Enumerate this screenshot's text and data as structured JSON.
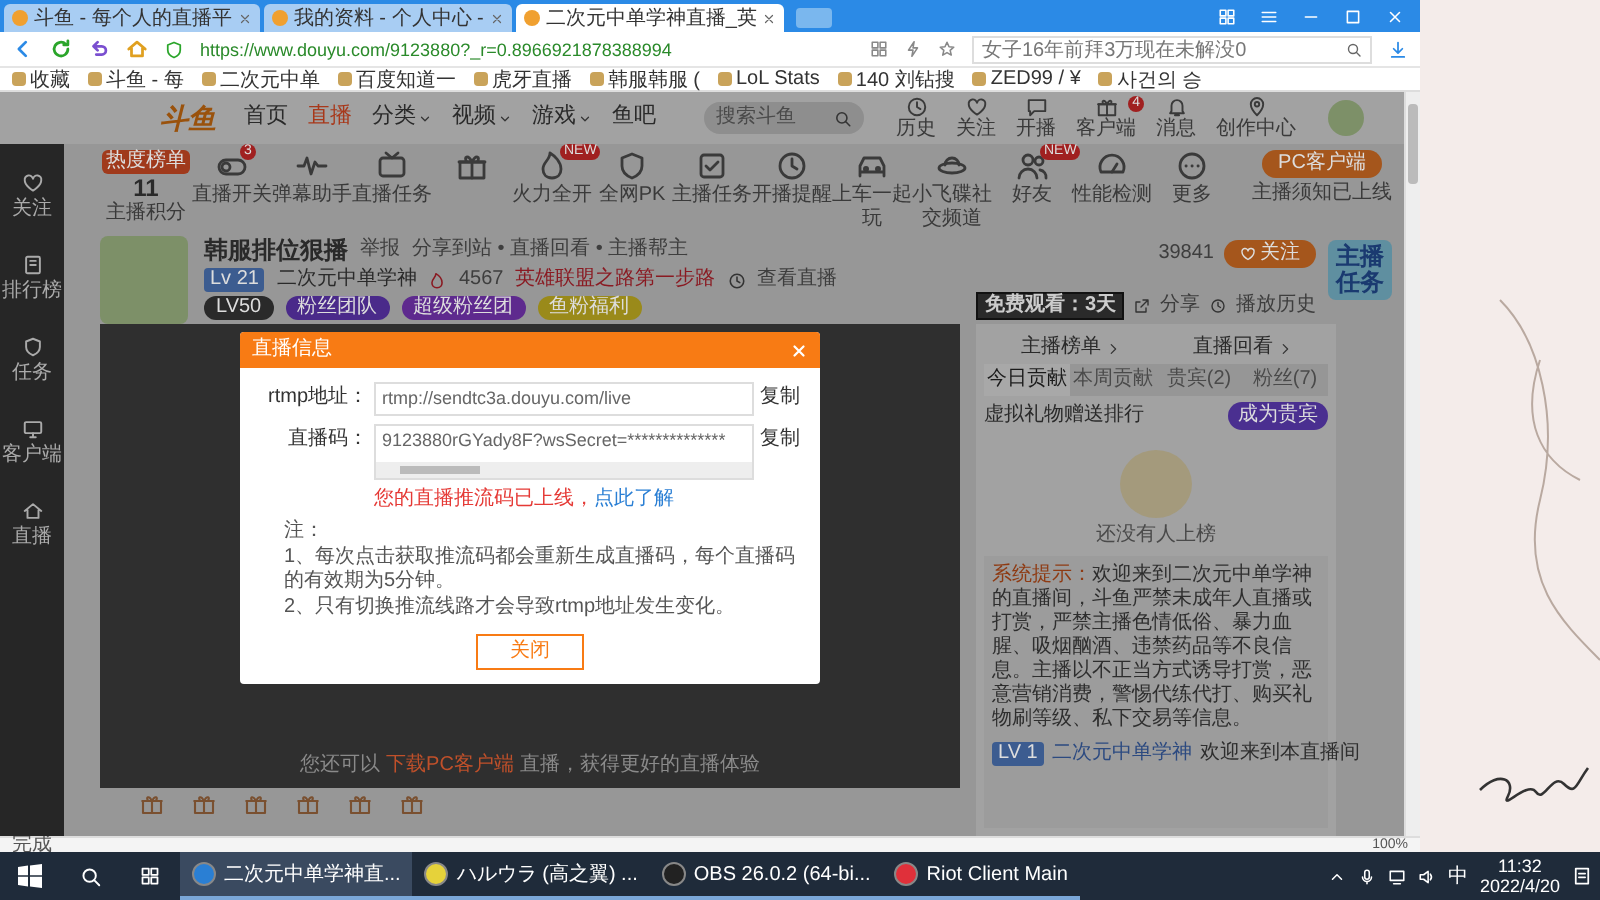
{
  "browser": {
    "tabs": [
      {
        "title": "斗鱼 - 每个人的直播平",
        "selected": false
      },
      {
        "title": "我的资料 - 个人中心 - ",
        "selected": false
      },
      {
        "title": "二次元中单学神直播_英",
        "selected": true
      }
    ],
    "url": "https://www.douyu.com/9123880?_r=0.8966921878388994",
    "search": "女子16年前拜3万现在未解没0",
    "bookmarks": [
      "收藏",
      "斗鱼 - 每",
      "二次元中单",
      "百度知道一",
      "虎牙直播",
      "韩服韩服 (",
      "LoL Stats",
      "140 刘钻搜",
      "ZED99 / ¥",
      "사건의 승"
    ],
    "status": "完成",
    "zoom": "100%"
  },
  "header": {
    "logo": "斗鱼",
    "nav": [
      {
        "label": "首页",
        "selected": false,
        "menu": false
      },
      {
        "label": "直播",
        "selected": true,
        "menu": false
      },
      {
        "label": "分类",
        "selected": false,
        "menu": true
      },
      {
        "label": "视频",
        "selected": false,
        "menu": true
      },
      {
        "label": "游戏",
        "selected": false,
        "menu": true
      },
      {
        "label": "鱼吧",
        "selected": false,
        "menu": false
      }
    ],
    "search_placeholder": "搜索斗鱼",
    "icons": [
      {
        "label": "历史",
        "kind": "clock"
      },
      {
        "label": "关注",
        "kind": "heart"
      },
      {
        "label": "开播",
        "kind": "chat"
      },
      {
        "label": "客户端",
        "kind": "gift",
        "badge": "4"
      },
      {
        "label": "消息",
        "kind": "bell"
      },
      {
        "label": "创作中心",
        "kind": "pin"
      }
    ]
  },
  "sidebar": [
    {
      "label": "关注",
      "kind": "heart"
    },
    {
      "label": "排行榜",
      "kind": "book"
    },
    {
      "label": "任务",
      "kind": "shield"
    },
    {
      "label": "客户端",
      "kind": "screen"
    },
    {
      "label": "直播",
      "kind": "home"
    }
  ],
  "toolbar": {
    "score": {
      "tag": "热度榜单",
      "value": "11",
      "label": "主播积分"
    },
    "tools": [
      {
        "label": "直播开关",
        "kind": "toggle",
        "badge": "3"
      },
      {
        "label": "弹幕助手",
        "kind": "wave"
      },
      {
        "label": "直播任务",
        "kind": "tv"
      },
      {
        "kind": "gift"
      },
      {
        "label": "火力全开",
        "kind": "fire",
        "badge": "NEW"
      },
      {
        "label": "全网PK",
        "kind": "shield"
      },
      {
        "label": "主播任务",
        "kind": "check"
      },
      {
        "label": "开播提醒",
        "kind": "clock"
      },
      {
        "label": "上车一起玩",
        "kind": "car"
      },
      {
        "label": "小飞碟社交频道",
        "kind": "ufo"
      },
      {
        "label": "好友",
        "kind": "people",
        "badge": "NEW"
      },
      {
        "label": "性能检测",
        "kind": "gauge"
      },
      {
        "label": "更多",
        "kind": "more"
      }
    ],
    "client_button": "PC客户端",
    "client_note": "主播须知已上线"
  },
  "room": {
    "title": "韩服排位狠播",
    "report": "举报",
    "meta": "分享到站 • 直播回看 • 主播帮主",
    "level": "Lv 21",
    "anchor": "二次元中单学神",
    "hot": "4567",
    "rank": "英雄联盟之路第一步路",
    "watch": "查看直播",
    "followers": "39841",
    "follow": "关注",
    "tags": [
      {
        "label": "LV50",
        "color": "#2a2a2a"
      },
      {
        "label": "粉丝团队",
        "color": "#4a2a8a"
      },
      {
        "label": "超级粉丝团",
        "color": "#5e2a8e"
      },
      {
        "label": "鱼粉福利",
        "color": "#9a8a1a"
      }
    ],
    "free": "免费观看：3天",
    "share": "分享",
    "history": "播放历史"
  },
  "video": {
    "hint_before": "您还可以",
    "hint_link": "下载PC客户端",
    "hint_after": "直播，获得更好的直播体验"
  },
  "modal": {
    "title": "直播信息",
    "rows": [
      {
        "kind": "input",
        "label": "rtmp地址：",
        "value": "rtmp://sendtc3a.douyu.com/live",
        "action": "复制"
      },
      {
        "kind": "textarea",
        "label": "直播码：",
        "value": "9123880rGYady8F?wsSecret=**************",
        "action": "复制"
      }
    ],
    "warning": "您的直播推流码已上线，",
    "warning_link": "点此了解",
    "notes": [
      "注：",
      "1、每次点击获取推流码都会重新生成直播码，每个直播码的有效期为5分钟。",
      "2、只有切换推流线路才会导致rtmp地址发生变化。"
    ],
    "close_button": "关闭"
  },
  "panel": {
    "links": [
      "主播榜单",
      "直播回看"
    ],
    "tabs": [
      {
        "label": "今日贡献",
        "selected": true
      },
      {
        "label": "本周贡献",
        "selected": false
      },
      {
        "label": "贵宾(2)",
        "selected": false
      },
      {
        "label": "粉丝(7)",
        "selected": false
      }
    ],
    "note": "虚拟礼物赠送排行",
    "vip_button": "成为贵宾",
    "empty": "还没有人上榜",
    "sticker": "主播任务",
    "system_tag": "系统提示：",
    "system_text": "欢迎来到二次元中单学神的直播间，斗鱼严禁未成年人直播或打赏，严禁主播色情低俗、暴力血腥、吸烟酗酒、违禁药品等不良信息。主播以不正当方式诱导打赏，恶意营销消费，警惕代练代打、购买礼物刷等级、私下交易等信息。",
    "welcome": {
      "level": "LV 1",
      "name": "二次元中单学神",
      "text": "欢迎来到本直播间"
    }
  },
  "taskbar": {
    "apps": [
      {
        "label": "二次元中单学神直...",
        "selected": true,
        "kind": "browser"
      },
      {
        "label": "ハルウラ (高之翼) ...",
        "selected": false,
        "kind": "music"
      },
      {
        "label": "OBS 26.0.2 (64-bi...",
        "selected": false,
        "kind": "obs"
      },
      {
        "label": "Riot Client Main",
        "selected": false,
        "kind": "riot"
      }
    ],
    "ime": "中",
    "time": "11:32",
    "date": "2022/4/20"
  }
}
